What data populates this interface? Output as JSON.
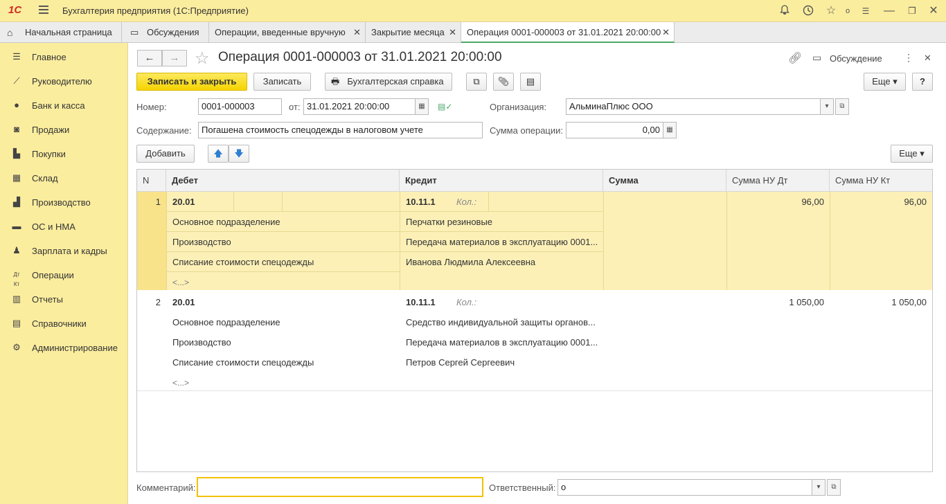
{
  "titlebar": {
    "logo": "1С",
    "app_title": "Бухгалтерия предприятия  (1С:Предприятие)",
    "user_badge": "o"
  },
  "tabs": [
    {
      "label": "Начальная страница"
    },
    {
      "label": "Обсуждения"
    },
    {
      "label": "Операции, введенные вручную"
    },
    {
      "label": "Закрытие месяца"
    },
    {
      "label": "Операция 0001-000003 от 31.01.2021 20:00:00"
    }
  ],
  "sidebar": {
    "items": [
      {
        "label": "Главное",
        "icon": "menu-icon"
      },
      {
        "label": "Руководителю",
        "icon": "trend-icon"
      },
      {
        "label": "Банк и касса",
        "icon": "coin-icon"
      },
      {
        "label": "Продажи",
        "icon": "bag-icon"
      },
      {
        "label": "Покупки",
        "icon": "cart-icon"
      },
      {
        "label": "Склад",
        "icon": "warehouse-icon"
      },
      {
        "label": "Производство",
        "icon": "factory-icon"
      },
      {
        "label": "ОС и НМА",
        "icon": "truck-icon"
      },
      {
        "label": "Зарплата и кадры",
        "icon": "person-icon"
      },
      {
        "label": "Операции",
        "icon": "dt-kt-icon"
      },
      {
        "label": "Отчеты",
        "icon": "chart-icon"
      },
      {
        "label": "Справочники",
        "icon": "book-icon"
      },
      {
        "label": "Администрирование",
        "icon": "gear-icon"
      }
    ]
  },
  "form": {
    "title": "Операция 0001-000003 от 31.01.2021 20:00:00",
    "discussion_label": "Обсуждение",
    "toolbar": {
      "save_close": "Записать и закрыть",
      "save": "Записать",
      "report": "Бухгалтерская справка",
      "more": "Еще",
      "help": "?"
    },
    "number_label": "Номер:",
    "number_value": "0001-000003",
    "date_label": "от:",
    "date_value": "31.01.2021 20:00:00",
    "org_label": "Организация:",
    "org_value": "АльминаПлюс ООО",
    "content_label": "Содержание:",
    "content_value": "Погашена стоимость спецодежды в налоговом учете",
    "sum_label": "Сумма операции:",
    "sum_value": "0,00",
    "table_toolbar": {
      "add": "Добавить",
      "more": "Еще"
    },
    "comment_label": "Комментарий:",
    "comment_value": "",
    "responsible_label": "Ответственный:",
    "responsible_value": "o"
  },
  "table": {
    "columns": [
      "N",
      "Дебет",
      "Кредит",
      "Сумма",
      "Сумма НУ Дт",
      "Сумма НУ Кт"
    ],
    "rows": [
      {
        "n": "1",
        "debit": "20.01",
        "debit_lines": [
          "Основное подразделение",
          "Производство",
          "Списание стоимости спецодежды",
          "<...>"
        ],
        "credit": "10.11.1",
        "qty": "Кол.:",
        "credit_lines": [
          "Перчатки резиновые",
          "Передача материалов в эксплуатацию 0001...",
          "Иванова Людмила Алексеевна"
        ],
        "sum": "",
        "nu_dt": "96,00",
        "nu_kt": "96,00"
      },
      {
        "n": "2",
        "debit": "20.01",
        "debit_lines": [
          "Основное подразделение",
          "Производство",
          "Списание стоимости спецодежды",
          "<...>"
        ],
        "credit": "10.11.1",
        "qty": "Кол.:",
        "credit_lines": [
          "Средство индивидуальной защиты органов...",
          "Передача материалов в эксплуатацию 0001...",
          "Петров Сергей Сергеевич"
        ],
        "sum": "",
        "nu_dt": "1 050,00",
        "nu_kt": "1 050,00"
      }
    ]
  },
  "colors": {
    "titlebar": "#fbed9e",
    "accent": "#f5d400",
    "selected_row": "#fcf0b7",
    "active_tab_underline": "#4ca86a"
  }
}
